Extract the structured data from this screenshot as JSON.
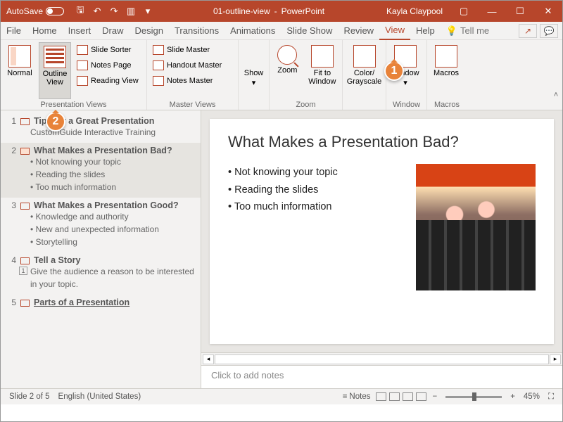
{
  "titlebar": {
    "autosave": "AutoSave",
    "docname": "01-outline-view",
    "appname": "PowerPoint",
    "user": "Kayla Claypool"
  },
  "tabs": [
    "File",
    "Home",
    "Insert",
    "Draw",
    "Design",
    "Transitions",
    "Animations",
    "Slide Show",
    "Review",
    "View",
    "Help"
  ],
  "tellme": "Tell me",
  "ribbon": {
    "presviews": {
      "label": "Presentation Views",
      "normal": "Normal",
      "outline": "Outline View",
      "slidesorter": "Slide Sorter",
      "notespage": "Notes Page",
      "readingview": "Reading View"
    },
    "masterviews": {
      "label": "Master Views",
      "slidemaster": "Slide Master",
      "handoutmaster": "Handout Master",
      "notesmaster": "Notes Master"
    },
    "show": {
      "btn": "Show"
    },
    "zoom": {
      "label": "Zoom",
      "zoom": "Zoom",
      "fit": "Fit to Window"
    },
    "color": {
      "btn": "Color/ Grayscale"
    },
    "window": {
      "label": "Window",
      "btn": "Window"
    },
    "macros": {
      "label": "Macros",
      "btn": "Macros"
    }
  },
  "callouts": {
    "c1": "1",
    "c2": "2"
  },
  "outline": [
    {
      "num": "1",
      "title": "Tips for a Great Presentation",
      "sub": "CustomGuide Interactive Training",
      "bullets": []
    },
    {
      "num": "2",
      "title": "What Makes a Presentation Bad?",
      "sub": "",
      "bullets": [
        "Not knowing your topic",
        "Reading the slides",
        "Too much information"
      ]
    },
    {
      "num": "3",
      "title": "What Makes a Presentation Good?",
      "sub": "",
      "bullets": [
        "Knowledge and authority",
        "New and unexpected information",
        "Storytelling"
      ]
    },
    {
      "num": "4",
      "title": "Tell a Story",
      "sub": "Give the audience a reason to be interested in your topic.",
      "bullets": [],
      "numbox": "1"
    },
    {
      "num": "5",
      "title": "Parts of a Presentation",
      "sub": "",
      "bullets": [],
      "underline": true
    }
  ],
  "slide": {
    "title": "What Makes a Presentation Bad?",
    "bullets": [
      "Not knowing your topic",
      "Reading the slides",
      "Too much information"
    ]
  },
  "notes_placeholder": "Click to add notes",
  "status": {
    "slideinfo": "Slide 2 of 5",
    "lang": "English (United States)",
    "notes": "Notes",
    "zoom": "45%"
  }
}
